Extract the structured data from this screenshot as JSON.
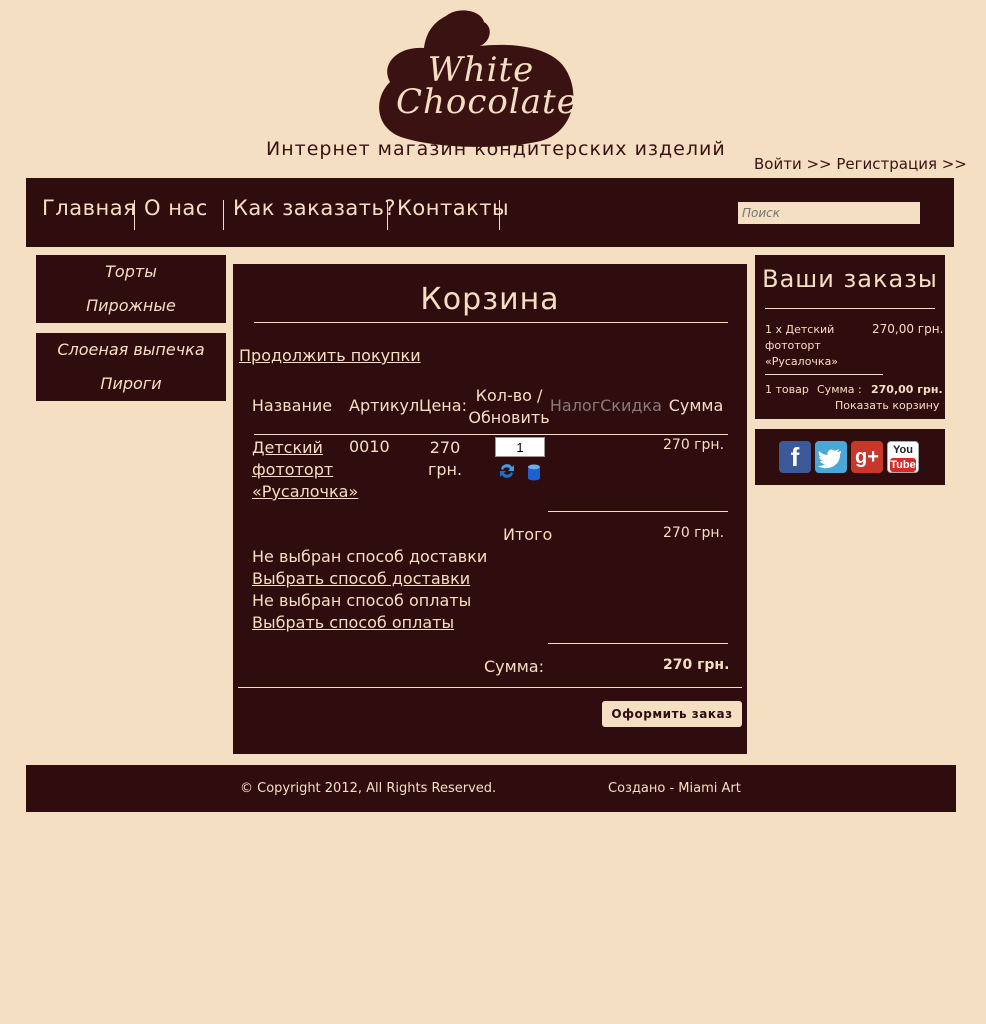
{
  "header": {
    "logo_line1": "White",
    "logo_line2": "Chocolate",
    "tagline": "Интернет магазин кондитерских изделий",
    "login": "Войти >>",
    "register": "Регистрация >>"
  },
  "nav": {
    "items": [
      "Главная",
      "О нас",
      "Как заказать?",
      "Контакты"
    ],
    "search_placeholder": "Поиск"
  },
  "sidebar": {
    "group1": [
      "Торты",
      "Пирожные"
    ],
    "group2": [
      "Слоеная выпечка",
      "Пироги"
    ]
  },
  "cart": {
    "title": "Корзина",
    "continue": "Продолжить покупки",
    "headers": {
      "name": "Название",
      "sku": "Артикул",
      "price": "Цена:",
      "qty": "Кол-во / Обновить",
      "tax": "Налог",
      "discount": "Скидка",
      "sum": "Сумма"
    },
    "item": {
      "name": "Детский фототорт «Русалочка»",
      "sku": "0010",
      "price": "270 грн.",
      "qty": "1",
      "sum": "270 грн."
    },
    "total_label": "Итого",
    "total_value": "270 грн.",
    "delivery_status": "Не выбран способ доставки",
    "delivery_link": "Выбрать способ доставки",
    "payment_status": "Не выбран способ оплаты",
    "payment_link": "Выбрать способ оплаты",
    "grand_label": "Сумма:",
    "grand_value": "270 грн.",
    "checkout_button": "Оформить заказ"
  },
  "orders": {
    "title": "Ваши заказы",
    "item_name": "1 x Детский фототорт «Русалочка»",
    "item_price": "270,00 грн.",
    "count": "1 товар",
    "sum_label": "Сумма :",
    "sum_value": "270,00 грн.",
    "show_cart": "Показать корзину"
  },
  "social": {
    "icons": [
      "facebook-icon",
      "twitter-icon",
      "google-plus-icon",
      "youtube-icon"
    ],
    "facebook": "f",
    "google": "g+",
    "youtube_you": "You",
    "youtube_tube": "Tube"
  },
  "footer": {
    "copyright": "© Copyright 2012, All Rights Reserved.",
    "credits": "Создано - Miami Art"
  },
  "colors": {
    "background": "#f5dfc2",
    "panel": "#2f0c0e",
    "text_light": "#f5dfc2"
  }
}
